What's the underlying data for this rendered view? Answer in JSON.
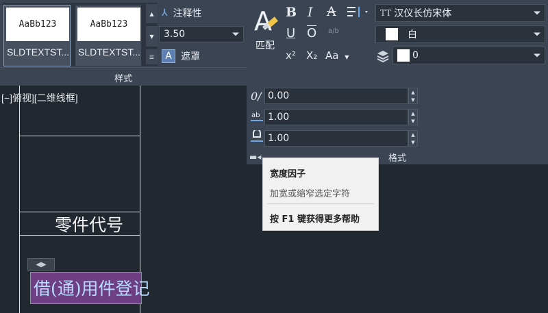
{
  "style_panel": {
    "styles": [
      {
        "preview": "AaBb123",
        "name": "SLDTEXTST..."
      },
      {
        "preview": "AaBb123",
        "name": "SLDTEXTST..."
      }
    ],
    "annotative_label": "注释性",
    "text_height": "3.50",
    "mask_label": "遮罩",
    "panel_title": "样式"
  },
  "format_panel": {
    "match_label": "匹配",
    "font_name": "汉仪长仿宋体",
    "color_name": "白",
    "layer_value": "0",
    "oblique_angle": "0.00",
    "tracking": "1.00",
    "width_factor": "1.00",
    "panel_title": "格式",
    "icons": {
      "bold": "B",
      "italic": "I",
      "strikethrough": "A",
      "underline": "U",
      "overline": "O",
      "stack": "a/b",
      "superscript": "x²",
      "subscript": "X₂",
      "case": "Aa",
      "oblique": "0/",
      "tracking": "ab",
      "font_prefix": "TT"
    }
  },
  "tooltip": {
    "title": "宽度因子",
    "description": "加宽或缩窄选定字符",
    "help": "按 F1 键获得更多帮助"
  },
  "drawing": {
    "viewport_label": "[−]俯视][二维线框]",
    "part_code_text": "零件代号",
    "editing_text": "借(通)用件登记"
  },
  "colors": {
    "ribbon": "#3b4453",
    "canvas": "#212830",
    "edit_highlight": "#6f3f86"
  }
}
